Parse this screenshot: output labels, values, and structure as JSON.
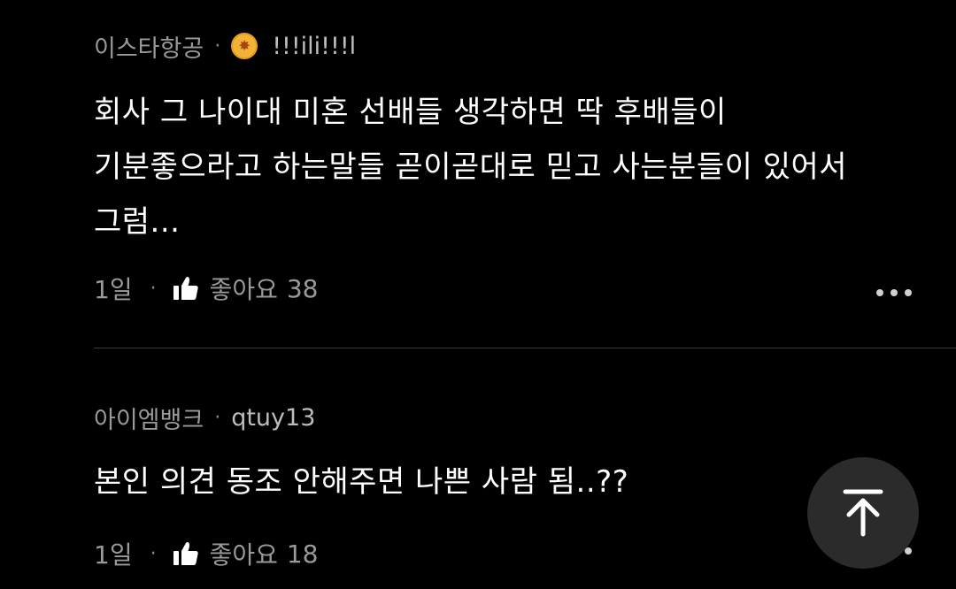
{
  "comments": [
    {
      "source": "이스타항공",
      "nickname": "!!!ili!!!l",
      "text": "회사 그 나이대 미혼 선배들 생각하면 딱 후배들이\n기분좋으라고 하는말들 곧이곧대로 믿고 사는분들이 있어서\n그럼...",
      "time": "1일",
      "like_label": "좋아요",
      "like_count": "38"
    },
    {
      "source": "아이엠뱅크",
      "nickname": "qtuy13",
      "text": "본인 의견 동조 안해주면 나쁜 사람 됨..??",
      "time": "1일",
      "like_label": "좋아요",
      "like_count": "18"
    }
  ],
  "separator": "·",
  "icons": {
    "badge": "gold-badge-icon",
    "like": "thumbs-up-icon",
    "more": "more-options-icon",
    "scroll_top": "arrow-up-icon"
  },
  "colors": {
    "background": "#000000",
    "text_primary": "#ffffff",
    "text_secondary": "#9a9a9a",
    "badge": "#f2b237",
    "fab_background": "#2b2b2b"
  }
}
